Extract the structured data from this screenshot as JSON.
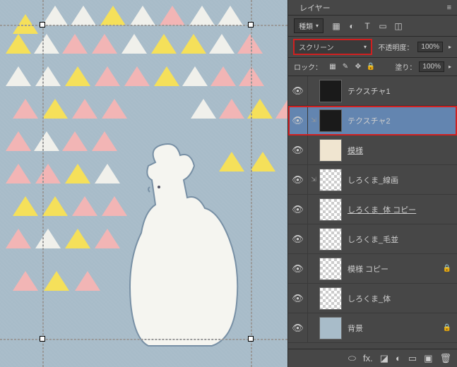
{
  "panel": {
    "title": "レイヤー",
    "filter_label": "種類",
    "blend_mode": "スクリーン",
    "opacity_label": "不透明度：",
    "opacity_value": "100%",
    "lock_label": "ロック：",
    "fill_label": "塗り：",
    "fill_value": "100%"
  },
  "layers": [
    {
      "name": "テクスチャ1",
      "vis": "👁",
      "thumb": "dark",
      "linked": false,
      "underline": false,
      "selected": false,
      "locked": false,
      "highlight": false
    },
    {
      "name": "テクスチャ2",
      "vis": "👁",
      "thumb": "dark",
      "linked": true,
      "underline": false,
      "selected": true,
      "locked": false,
      "highlight": true
    },
    {
      "name": "模様",
      "vis": "👁",
      "thumb": "pat",
      "linked": false,
      "underline": true,
      "selected": false,
      "locked": false,
      "highlight": false
    },
    {
      "name": "しろくま_線画",
      "vis": "👁",
      "thumb": "checker",
      "linked": true,
      "underline": false,
      "selected": false,
      "locked": false,
      "highlight": false
    },
    {
      "name": "しろくま_体 コピー",
      "vis": "👁",
      "thumb": "checker",
      "linked": false,
      "underline": true,
      "selected": false,
      "locked": false,
      "highlight": false
    },
    {
      "name": "しろくま_毛並",
      "vis": "👁",
      "thumb": "checker",
      "linked": false,
      "underline": false,
      "selected": false,
      "locked": false,
      "highlight": false
    },
    {
      "name": "模様 コピー",
      "vis": "👁",
      "thumb": "checker",
      "linked": false,
      "underline": false,
      "selected": false,
      "locked": true,
      "highlight": false
    },
    {
      "name": "しろくま_体",
      "vis": "👁",
      "thumb": "checker",
      "linked": false,
      "underline": false,
      "selected": false,
      "locked": false,
      "highlight": false
    },
    {
      "name": "背景",
      "vis": "👁",
      "thumb": "blue",
      "linked": false,
      "underline": false,
      "selected": false,
      "locked": true,
      "highlight": false
    }
  ],
  "icons": {
    "menu": "≡",
    "img_filter": "▦",
    "adj_filter": "◐",
    "type_filter": "T",
    "shape_filter": "▭",
    "smart_filter": "◫",
    "lock_trans": "▦",
    "lock_brush": "✎",
    "lock_move": "✥",
    "lock_all": "🔒",
    "link": "⬭",
    "fx": "fx.",
    "mask": "◪",
    "adj": "◐",
    "group": "▭",
    "new": "▣",
    "trash": "🗑"
  }
}
